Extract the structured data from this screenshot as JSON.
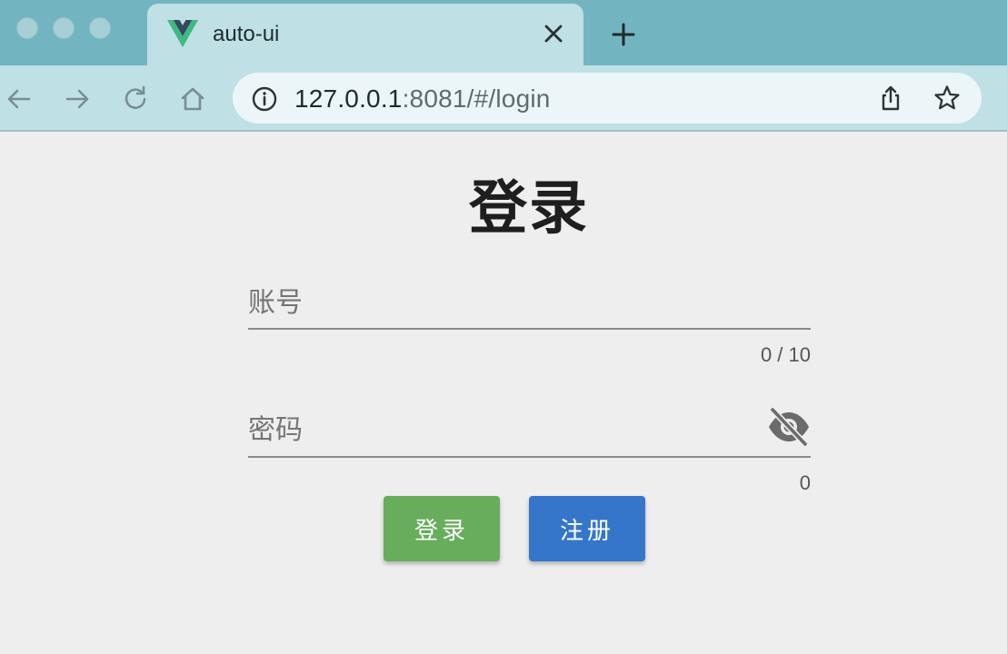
{
  "browser": {
    "tab_title": "auto-ui",
    "url_host": "127.0.0.1",
    "url_rest": ":8081/#/login"
  },
  "page": {
    "title": "登录",
    "account_placeholder": "账号",
    "account_value": "",
    "account_counter": "0 / 10",
    "password_placeholder": "密码",
    "password_value": "",
    "password_counter": "0",
    "login_button": "登录",
    "register_button": "注册"
  },
  "colors": {
    "login_button": "#67ad5b",
    "register_button": "#3576cb",
    "tabstrip": "#72b5c1",
    "toolbar": "#bfe0e4"
  },
  "icons": [
    "vue-logo-icon",
    "close-icon",
    "plus-icon",
    "back-icon",
    "forward-icon",
    "reload-icon",
    "home-icon",
    "info-icon",
    "share-icon",
    "star-icon",
    "eye-off-icon"
  ]
}
